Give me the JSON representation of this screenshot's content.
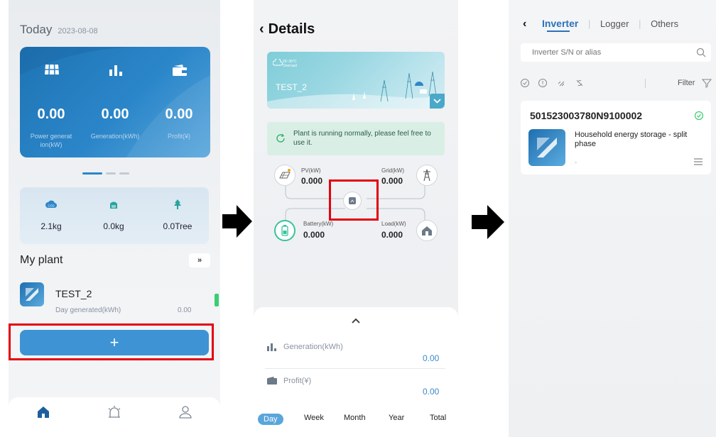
{
  "colors": {
    "accent": "#3d93d4",
    "highlight": "#e4000f",
    "ok": "#3ccd74",
    "arrow": "#000000"
  },
  "screen1": {
    "today_label": "Today",
    "date": "2023-08-08",
    "stats": [
      {
        "icon": "solar-panel-icon",
        "value": "0.00",
        "label": "Power generat ion(kW)"
      },
      {
        "icon": "bar-chart-icon",
        "value": "0.00",
        "label": "Generation(kWh)"
      },
      {
        "icon": "wallet-icon",
        "value": "0.00",
        "label": "Profit(¥)"
      }
    ],
    "environment": [
      {
        "icon": "co2-cloud-icon",
        "value": "2.1kg"
      },
      {
        "icon": "coal-icon",
        "value": "0.0kg"
      },
      {
        "icon": "tree-icon",
        "value": "0.0Tree"
      }
    ],
    "my_plant": "My plant",
    "more": "»",
    "plant": {
      "name": "TEST_2",
      "sub": "Day generated(kWh)",
      "value": "0.00"
    },
    "add_label": "+",
    "tabbar": [
      "home-icon",
      "alarm-icon",
      "user-icon"
    ]
  },
  "screen2": {
    "title": "Details",
    "weather": {
      "temp": "26~35°C",
      "condition": "Overcast"
    },
    "plant_name": "TEST_2",
    "notice": "Plant is running normally, please feel free to use it.",
    "pv": {
      "label": "PV(kW)",
      "value": "0.000"
    },
    "grid": {
      "label": "Grid(kW)",
      "value": "0.000"
    },
    "battery": {
      "label": "Battery(kW)",
      "value": "0.000"
    },
    "load": {
      "label": "Load(kW)",
      "value": "0.000"
    },
    "generation": {
      "label": "Generation(kWh)",
      "value": "0.00"
    },
    "profit": {
      "label": "Profit(¥)",
      "value": "0.00"
    },
    "periods": [
      "Day",
      "Week",
      "Month",
      "Year",
      "Total"
    ]
  },
  "screen3": {
    "tabs": [
      "Inverter",
      "Logger",
      "Others"
    ],
    "search_placeholder": "Inverter S/N or alias",
    "filter_label": "Filter",
    "inverter": {
      "sn": "501523003780N9100002",
      "type": "Household energy storage - split phase",
      "alias": "-"
    }
  }
}
